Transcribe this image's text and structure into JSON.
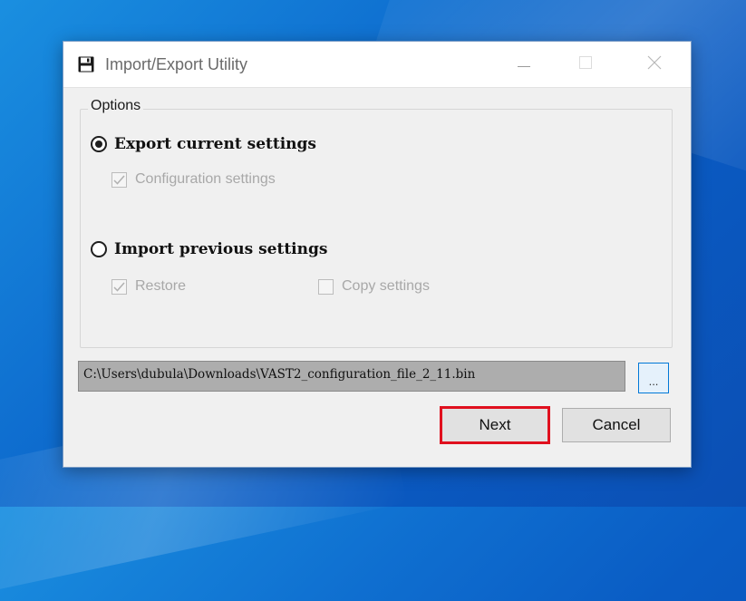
{
  "window": {
    "title": "Import/Export Utility",
    "icon": "floppy-disk-icon"
  },
  "title_controls": {
    "minimize_icon": "minimize-icon",
    "maximize_icon": "maximize-icon",
    "close_icon": "close-icon"
  },
  "options": {
    "group_label": "Options",
    "export_radio": {
      "label": "Export current settings",
      "selected": true
    },
    "config_checkbox": {
      "label": "Configuration settings",
      "checked": true,
      "enabled": false
    },
    "import_radio": {
      "label": "Import previous settings",
      "selected": false
    },
    "restore_checkbox": {
      "label": "Restore",
      "checked": true,
      "enabled": false
    },
    "copy_checkbox": {
      "label": "Copy settings",
      "checked": false,
      "enabled": false
    }
  },
  "file": {
    "path": "C:\\Users\\dubula\\Downloads\\VAST2_configuration_file_2_11.bin",
    "browse_label": "..."
  },
  "buttons": {
    "next_label": "Next",
    "cancel_label": "Cancel"
  },
  "colors": {
    "highlight": "#e0101e",
    "desktop_blue": "#0f6fd0"
  }
}
